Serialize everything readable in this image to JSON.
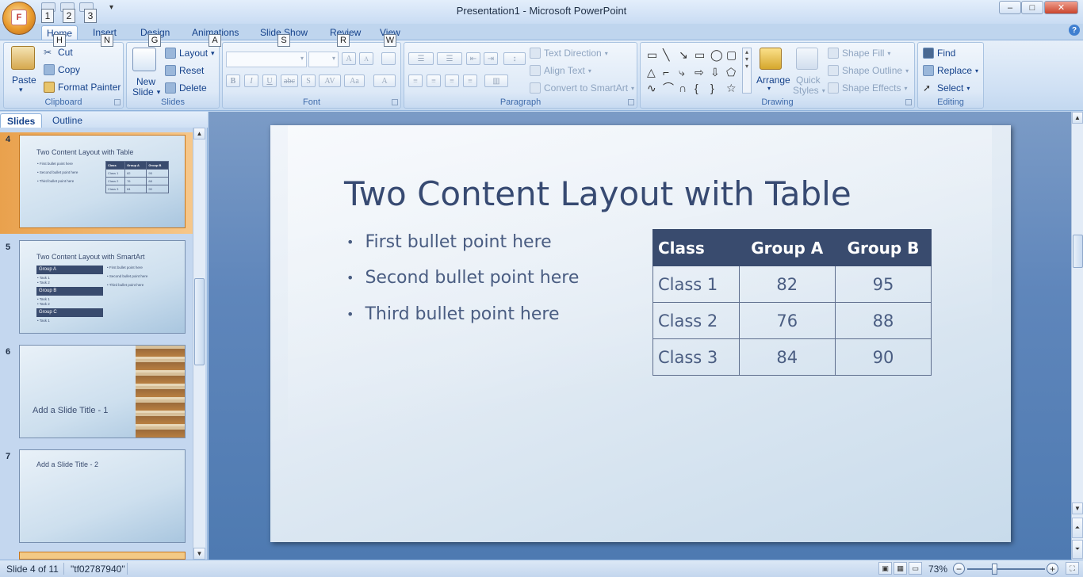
{
  "window": {
    "title": "Presentation1 - Microsoft PowerPoint",
    "office_button_letter": "F",
    "minimize": "–",
    "maximize": "□",
    "close": "✕"
  },
  "qat": {
    "keytips": [
      "1",
      "2",
      "3"
    ],
    "customize": "▾"
  },
  "tabs": [
    {
      "label": "Home",
      "key": "H"
    },
    {
      "label": "Insert",
      "key": "N"
    },
    {
      "label": "Design",
      "key": "G"
    },
    {
      "label": "Animations",
      "key": "A"
    },
    {
      "label": "Slide Show",
      "key": "S"
    },
    {
      "label": "Review",
      "key": "R"
    },
    {
      "label": "View",
      "key": "W"
    }
  ],
  "help": "?",
  "ribbon": {
    "clipboard": {
      "label": "Clipboard",
      "paste": "Paste",
      "cut": "Cut",
      "copy": "Copy",
      "format_painter": "Format Painter"
    },
    "slides": {
      "label": "Slides",
      "new_slide_1": "New",
      "new_slide_2": "Slide",
      "layout": "Layout",
      "reset": "Reset",
      "delete": "Delete"
    },
    "font": {
      "label": "Font",
      "bold": "B",
      "italic": "I",
      "underline": "U",
      "strike": "abc",
      "shadow": "S",
      "spacing": "AV",
      "case": "Aa",
      "color": "A",
      "grow": "A",
      "shrink": "A"
    },
    "paragraph": {
      "label": "Paragraph",
      "text_direction": "Text Direction",
      "align_text": "Align Text",
      "convert_smartart": "Convert to SmartArt"
    },
    "drawing": {
      "label": "Drawing",
      "arrange": "Arrange",
      "quick_styles_1": "Quick",
      "quick_styles_2": "Styles",
      "shape_fill": "Shape Fill",
      "shape_outline": "Shape Outline",
      "shape_effects": "Shape Effects"
    },
    "editing": {
      "label": "Editing",
      "find": "Find",
      "replace": "Replace",
      "select": "Select"
    }
  },
  "left_pane": {
    "tabs": [
      "Slides",
      "Outline"
    ],
    "close": "×",
    "thumbnails": [
      {
        "num": "4",
        "title": "Two Content Layout with Table",
        "bullets": [
          "• First bullet point here",
          "• Second bullet point here",
          "• Third bullet point here"
        ],
        "table": [
          [
            "Class",
            "Group A",
            "Group B"
          ],
          [
            "Class 1",
            "82",
            "95"
          ],
          [
            "Class 2",
            "76",
            "88"
          ],
          [
            "Class 3",
            "84",
            "90"
          ]
        ]
      },
      {
        "num": "5",
        "title": "Two Content Layout with SmartArt",
        "groups": [
          {
            "name": "Group A",
            "tasks": [
              "• Task 1",
              "• Task 2"
            ]
          },
          {
            "name": "Group B",
            "tasks": [
              "• Task 1",
              "• Task 2"
            ]
          },
          {
            "name": "Group C",
            "tasks": [
              "• Task 1"
            ]
          }
        ],
        "bullets": [
          "• First bullet point here",
          "• Second bullet point here",
          "• Third bullet point here"
        ]
      },
      {
        "num": "6",
        "title": "Add a Slide Title - 1"
      },
      {
        "num": "7",
        "title": "Add a Slide Title - 2"
      }
    ]
  },
  "slide": {
    "title": "Two Content Layout with Table",
    "bullets": [
      "First bullet point here",
      "Second bullet point here",
      "Third bullet point here"
    ],
    "table": {
      "headers": [
        "Class",
        "Group A",
        "Group B"
      ],
      "rows": [
        [
          "Class 1",
          "82",
          "95"
        ],
        [
          "Class 2",
          "76",
          "88"
        ],
        [
          "Class 3",
          "84",
          "90"
        ]
      ]
    }
  },
  "status": {
    "slide_info": "Slide 4 of 11",
    "theme": "\"tf02787940\"",
    "zoom": "73%",
    "zoom_out": "−",
    "zoom_in": "+"
  },
  "colors": {
    "table_header": "#394b6e",
    "title_text": "#374a72",
    "ribbon_text": "#15428b",
    "selected_thumb": "#e9a14d"
  }
}
